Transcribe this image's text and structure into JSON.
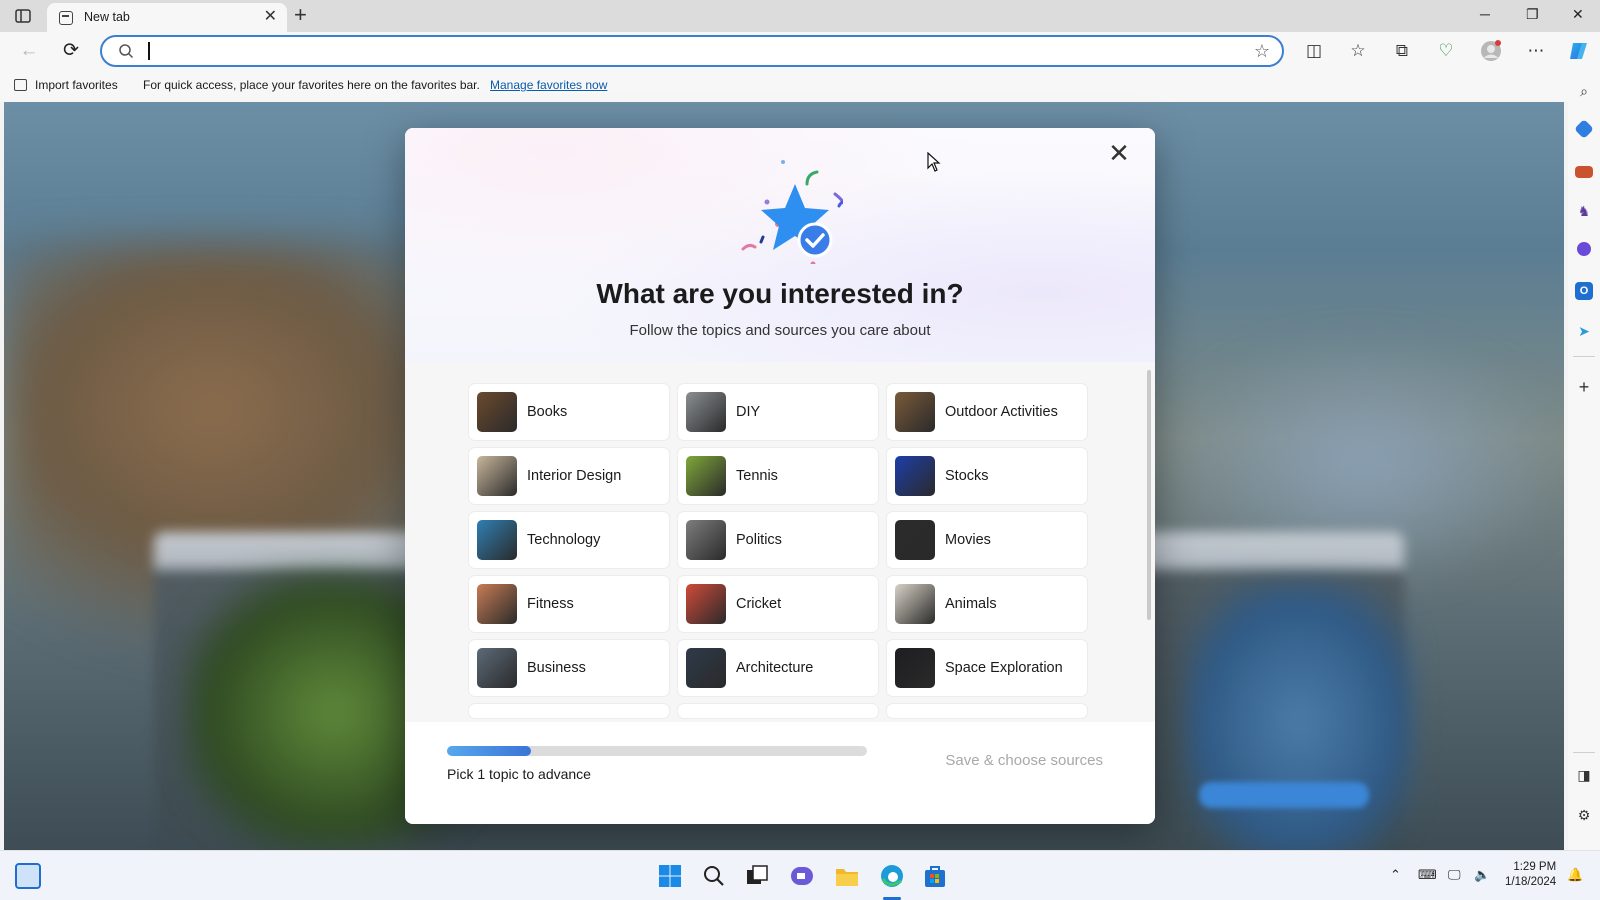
{
  "browser": {
    "tab_title": "New tab",
    "tab_close": "✕",
    "new_tab": "+",
    "window_controls": [
      "─",
      "❐",
      "✕"
    ],
    "address_value": "",
    "toolbar_icons": [
      "split-screen",
      "favorites",
      "collections",
      "browser-essentials",
      "profile",
      "settings-more",
      "copilot"
    ]
  },
  "favorites_bar": {
    "import_label": "Import favorites",
    "message": "For quick access, place your favorites here on the favorites bar.",
    "manage_link": "Manage favorites now"
  },
  "modal": {
    "title": "What are you interested in?",
    "subtitle": "Follow the topics and sources you care about",
    "close": "✕",
    "topics": [
      {
        "label": "Books",
        "color": "#6b4a2e"
      },
      {
        "label": "DIY",
        "color": "#8a8f92"
      },
      {
        "label": "Outdoor Activities",
        "color": "#7a5a3a"
      },
      {
        "label": "Interior Design",
        "color": "#c8b79b"
      },
      {
        "label": "Tennis",
        "color": "#7fa83a"
      },
      {
        "label": "Stocks",
        "color": "#1d3ea8"
      },
      {
        "label": "Technology",
        "color": "#2f7fb3"
      },
      {
        "label": "Politics",
        "color": "#7d7d7d"
      },
      {
        "label": "Movies",
        "color": "#2b2b2b"
      },
      {
        "label": "Fitness",
        "color": "#c77c55"
      },
      {
        "label": "Cricket",
        "color": "#d04a3a"
      },
      {
        "label": "Animals",
        "color": "#d8d2c6"
      },
      {
        "label": "Business",
        "color": "#5c6a78"
      },
      {
        "label": "Architecture",
        "color": "#2e3a4a"
      },
      {
        "label": "Space Exploration",
        "color": "#1e1e22"
      }
    ],
    "progress": {
      "fraction": 0.2,
      "text": "Pick 1 topic to advance"
    },
    "save_label": "Save & choose sources"
  },
  "taskbar": {
    "time": "1:29 PM",
    "date": "1/18/2024"
  },
  "colors": {
    "accent": "#3a74d6",
    "link": "#0b5cad"
  }
}
